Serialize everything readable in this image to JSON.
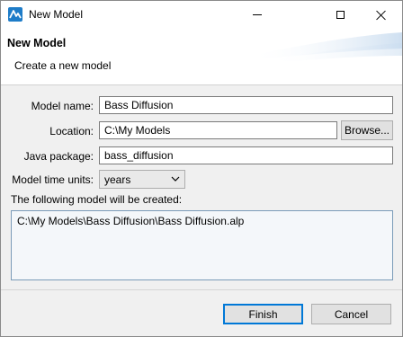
{
  "window": {
    "title": "New Model"
  },
  "header": {
    "title": "New Model",
    "subtitle": "Create a new model"
  },
  "form": {
    "model_name_label": "Model name:",
    "model_name_value": "Bass Diffusion",
    "location_label": "Location:",
    "location_value": "C:\\My Models",
    "browse_label": "Browse...",
    "java_package_label": "Java package:",
    "java_package_value": "bass_diffusion",
    "time_units_label": "Model time units:",
    "time_units_value": "years"
  },
  "output": {
    "caption": "The following model will be created:",
    "path": "C:\\My Models\\Bass Diffusion\\Bass Diffusion.alp"
  },
  "buttons": {
    "finish": "Finish",
    "cancel": "Cancel"
  },
  "colors": {
    "accent": "#0078d7",
    "output_border": "#7a9bb8"
  }
}
